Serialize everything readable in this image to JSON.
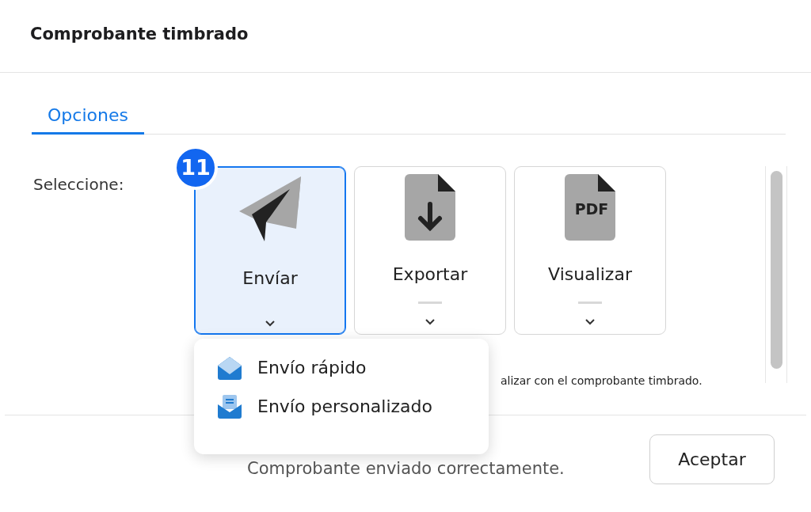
{
  "dialog": {
    "title": "Comprobante timbrado"
  },
  "tabs": [
    {
      "label": "Opciones",
      "selected": true
    }
  ],
  "prompt": "Seleccione:",
  "step_badge": "11",
  "options": [
    {
      "label": "Envíar",
      "kind": "send",
      "selected": true
    },
    {
      "label": "Exportar",
      "kind": "export",
      "selected": false
    },
    {
      "label": "Visualizar",
      "kind": "pdf",
      "selected": false
    }
  ],
  "pdf_icon_text": "PDF",
  "hint_text": "alizar con el comprobante timbrado.",
  "dropdown": [
    {
      "label": "Envío rápido",
      "kind": "quick"
    },
    {
      "label": "Envío personalizado",
      "kind": "custom"
    }
  ],
  "footer": {
    "message": "Comprobante enviado correctamente.",
    "button": "Aceptar"
  }
}
